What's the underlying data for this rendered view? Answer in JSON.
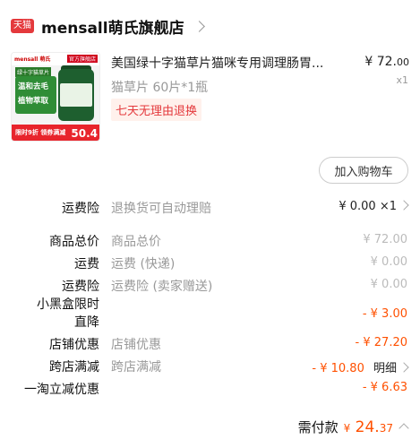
{
  "store": {
    "badge": "天猫",
    "name": "mensall萌氏旗舰店"
  },
  "product": {
    "image_texts": {
      "brand": "mensall 萌氏",
      "flag": "官方旗舰店",
      "tag1": "绿十字猫草片",
      "feature": "温和去毛 植物萃取",
      "promo": "限时9折  领券满减",
      "price": "50.4"
    },
    "title": "美国绿十字猫草片猫咪专用调理肠胃...",
    "spec": "猫草片 60片*1瓶",
    "return_tag": "七天无理由退换",
    "price_symbol": "¥",
    "price_int": "72.",
    "price_dec": "00",
    "quantity": "x1"
  },
  "add_cart_label": "加入购物车",
  "fees": [
    {
      "label": "运费险",
      "desc": "退换货可自动理赔",
      "value": "¥ 0.00 ×1"
    },
    {
      "label": "商品总价",
      "desc": "商品总价",
      "value": "¥ 72.00"
    },
    {
      "label": "运费",
      "desc": "运费 (快递)",
      "value": "¥ 0.00"
    },
    {
      "label": "运费险",
      "desc": "运费险 (卖家赠送)",
      "value": "¥ 0.00"
    },
    {
      "label": "小黑盒限时直降",
      "label_line1": "小黑盒限时",
      "label_line2": "直降",
      "desc": "",
      "value": "- ¥ 3.00"
    },
    {
      "label": "店铺优惠",
      "desc": "店铺优惠",
      "value": "- ¥ 27.20"
    },
    {
      "label": "跨店满减",
      "desc": "跨店满减",
      "value": "- ¥ 10.80",
      "link": "明细"
    },
    {
      "label": "一淘立减优惠",
      "desc": "",
      "value": "- ¥ 6.63"
    }
  ],
  "total": {
    "label": "需付款",
    "symbol": "¥",
    "int": "24.",
    "dec": "37"
  }
}
